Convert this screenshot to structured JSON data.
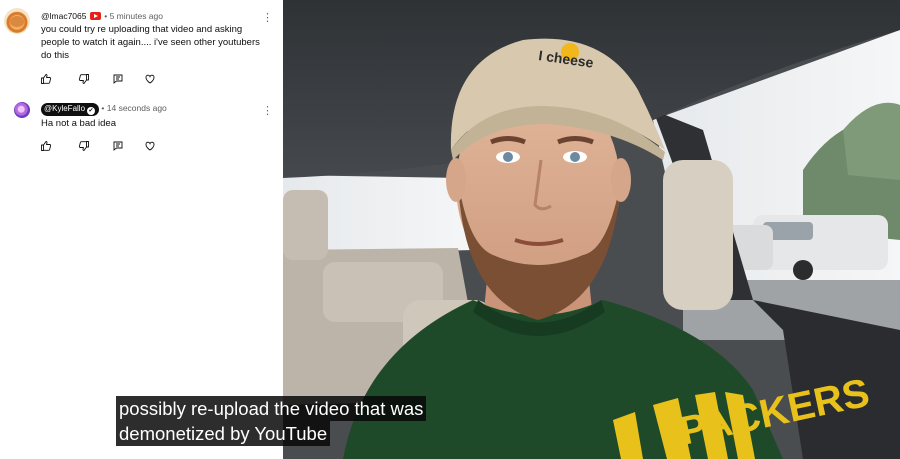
{
  "comments": [
    {
      "author": "@lmac7065",
      "badge_icon": "youtube-member-badge-icon",
      "time": "5 minutes ago",
      "text": "you could try re uploading that video and asking people to watch it again.... i've seen other youtubers do this"
    },
    {
      "author": "@KyleFallo",
      "verified_icon": "verified-check-icon",
      "time": "14 seconds ago",
      "text": "Ha not a bad idea"
    }
  ],
  "separator": "•",
  "icons": {
    "like": "thumbs-up-icon",
    "dislike": "thumbs-down-icon",
    "reply": "reply-icon",
    "heart": "heart-icon",
    "more": "more-vert-icon"
  },
  "video": {
    "cap_text": "I  cheese",
    "shirt_text": "PACKERS",
    "caption_lines": [
      "possibly re-upload the video that was",
      "demonetized by YouTube"
    ]
  },
  "colors": {
    "shirt": "#1f4a2a",
    "shirt_lettering": "#e8c21a",
    "cap": "#d7c8ae"
  }
}
